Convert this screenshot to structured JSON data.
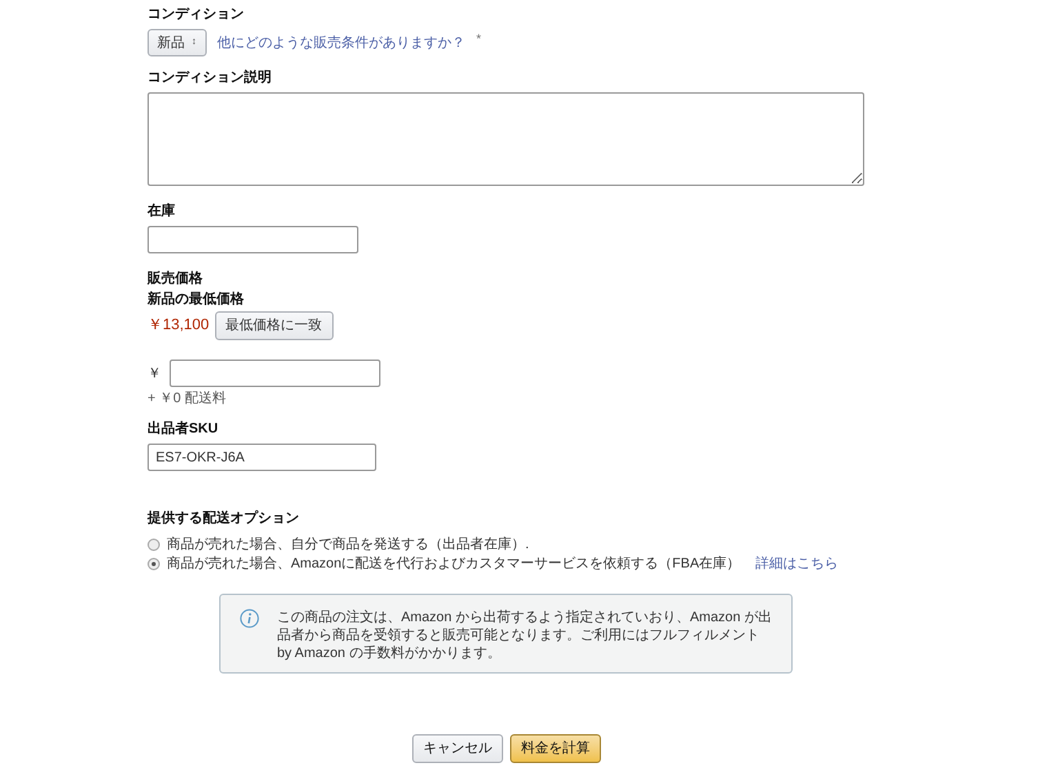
{
  "condition": {
    "label": "コンディション",
    "value": "新品",
    "caret": "↕",
    "help_link": "他にどのような販売条件がありますか？",
    "help_mark": "*"
  },
  "condition_note": {
    "label": "コンディション説明"
  },
  "stock": {
    "label": "在庫"
  },
  "price": {
    "label": "販売価格",
    "lowest_label": "新品の最低価格",
    "lowest_price": "￥13,100",
    "match_button": "最低価格に一致",
    "currency": "￥",
    "shipping": "+ ￥0 配送料"
  },
  "sku": {
    "label": "出品者SKU",
    "value": "ES7-OKR-J6A"
  },
  "fulfillment": {
    "label": "提供する配送オプション",
    "options": [
      {
        "label": "商品が売れた場合、自分で商品を発送する（出品者在庫）.",
        "selected": false
      },
      {
        "label": "商品が売れた場合、Amazonに配送を代行およびカスタマーサービスを依頼する（FBA在庫）",
        "selected": true,
        "link": "詳細はこちら"
      }
    ]
  },
  "notice": {
    "text": "この商品の注文は、Amazon から出荷するよう指定されていおり、Amazon が出品者から商品を受領すると販売可能となります。ご利用にはフルフィルメント by Amazon の手数料がかかります。"
  },
  "buttons": [
    {
      "label": "キャンセル",
      "kind": "secondary"
    },
    {
      "label": "料金を計算",
      "kind": "primary"
    }
  ]
}
